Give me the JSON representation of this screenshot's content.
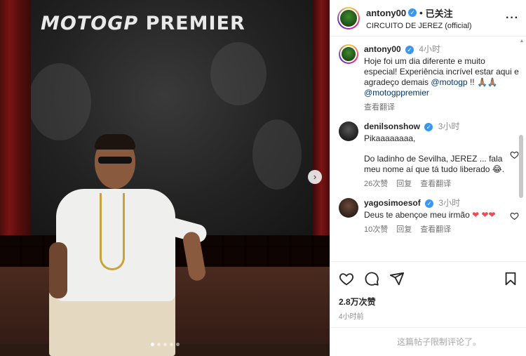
{
  "post": {
    "banner_text_left": "MOTO",
    "banner_text_gp": "GP",
    "banner_text_right": "PREMIER",
    "carousel_next_glyph": "›",
    "carousel_dot_count": 5,
    "carousel_active_dot": 0
  },
  "header": {
    "username": "antony00",
    "verified_glyph": "✓",
    "separator": "•",
    "follow_state": "已关注",
    "location": "CIRCUITO DE JEREZ (official)",
    "more_glyph": "···"
  },
  "caption": {
    "username": "antony00",
    "time": "4小时",
    "text_before_mention": "Hoje foi um dia diferente e muito especial! Experiência incrível estar aqui e agradeço demais ",
    "mention1": "@motogp",
    "text_after_mention": " !! 🙏🏽🙏🏽 ",
    "mention2": "@motogppremier",
    "translate": "查看翻译"
  },
  "comments": [
    {
      "username": "denilsonshow",
      "time": "3小时",
      "text_line1": "Pikaaaaaaaa,",
      "text_line2": "Do ladinho de Sevilha, JEREZ ... fala meu nome aí que tá tudo liberado 😂.",
      "likes": "26次赞",
      "reply": "回复",
      "translate": "查看翻译"
    },
    {
      "username": "yagosimoesof",
      "time": "3小时",
      "text": "Deus te abençoe meu irmão ",
      "hearts": "❤ ❤❤",
      "likes": "10次赞",
      "reply": "回复",
      "translate": "查看翻译"
    }
  ],
  "actions": {
    "likes_count": "2.8万次赞",
    "posted_ago": "4小时前",
    "comments_restricted": "这篇帖子限制评论了。"
  },
  "colors": {
    "verified": "#3897f0",
    "link": "#00376b",
    "heart_red": "#ed4956"
  }
}
